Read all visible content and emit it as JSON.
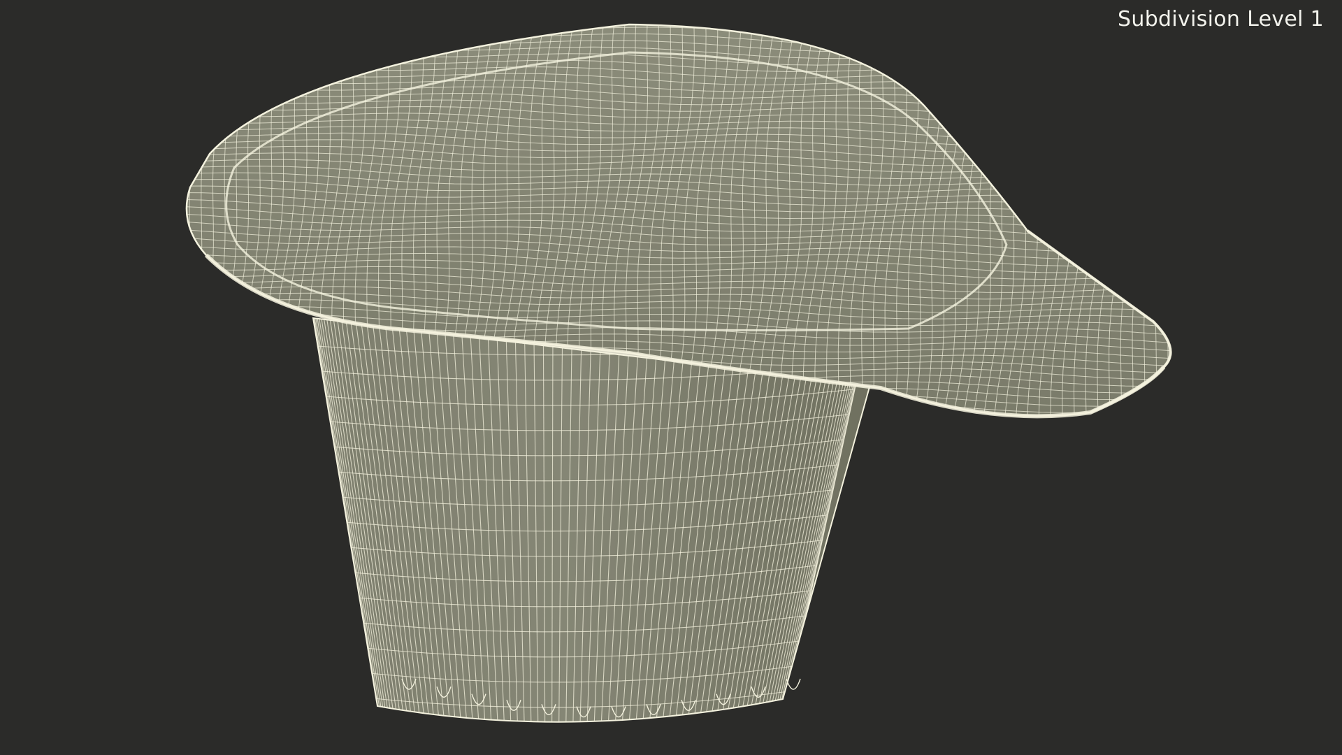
{
  "viewport": {
    "overlay_label": "Subdivision Level 1",
    "background_color": "#2b2b29",
    "model_fill_color": "#787968",
    "model_shade_color": "#6a6b5c",
    "wire_color": "#f4f2de"
  }
}
